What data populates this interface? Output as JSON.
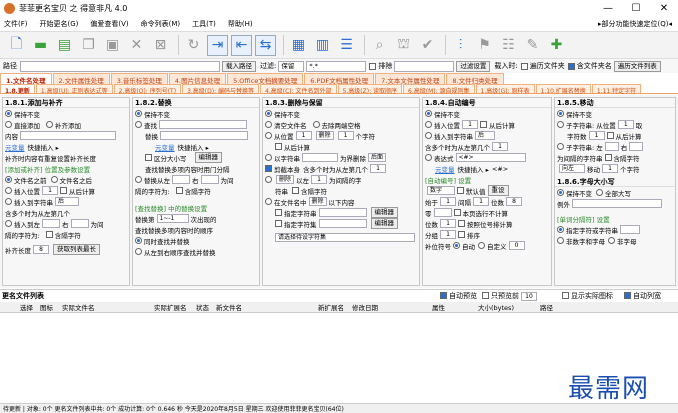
{
  "window": {
    "title": "菲菲更名宝贝 之 得意非凡 4.0"
  },
  "menu": {
    "items": [
      "文件(F)",
      "开始更名(G)",
      "偏爱查看(V)",
      "命令列表(M)",
      "工具(T)",
      "帮助(H)"
    ],
    "right": "▸部分功能快速定位(Q)◂"
  },
  "toolbar": {
    "icons": [
      "add-file-icon",
      "add-folder-icon",
      "add-folder-plus-icon",
      "copy-icon",
      "paste-icon",
      "delete-icon",
      "close-icon",
      "refresh-icon",
      "import-icon",
      "export-icon",
      "move-icon",
      "grid-icon",
      "table-icon",
      "list-icon",
      "search-icon",
      "theme-icon",
      "check-icon",
      "filter-icon",
      "flag-icon",
      "sliders-icon",
      "edit-icon",
      "pin-icon"
    ]
  },
  "pathbar": {
    "path_label": "路径",
    "path_value": "",
    "import_path": "载入路径",
    "filter_label": "过滤:",
    "filter_mode": "保留",
    "filter_value": "*.*",
    "exclude_label": "排除",
    "exclude_value": "",
    "filter_setting": "过滤设置",
    "load_label": "载入时:",
    "subfolder": "遍历文件夹",
    "include_folder": "含文件夹名",
    "traverse_list": "遍历文件列表"
  },
  "tabs": [
    "1.文件名处理",
    "2.文件属性处理",
    "3.音乐标签处理",
    "4.图片信息处理",
    "5.Office文档摘要处理",
    "6.PDF文档属性处理",
    "7.文本文件属性处理",
    "8.文件归类处理"
  ],
  "subtabs": [
    "1.8.更新",
    "1.高级(U): 正则表达式等",
    "2.高级(O): 序列号(T)",
    "3.高级(D): 编码与替换等",
    "4.高级(C): 文件名到外部",
    "5.高级(Z): 读取顺序",
    "6.高级(M): 源自规则集",
    "1.高级(G): 原样表",
    "1.10.扩展名替换",
    "1.11.特定字符"
  ],
  "panels": {
    "p1": {
      "title": "1.8.1.添加与补齐",
      "keep": "保持不变",
      "direct_add": "直接添加",
      "pad_add": "补齐添加",
      "content_label": "内容",
      "var_link": "元变量",
      "quick_insert": "快捷插入 ▸",
      "clear_insert": "补齐时内容有重复设置补齐长度",
      "group_head": "[添加或补齐] 位置及参数设置",
      "before_name": "文件名之前",
      "after_name": "文件名之后",
      "insert_pos": "插入位置",
      "pos_val": "1",
      "from_right": "从后计算",
      "insert_to_str": "插入到字符串",
      "after_lbl": "后",
      "multi_occur": "含多个时为从左第几个",
      "insert_to": "插入到左",
      "right_lbl": "右",
      "as_space": "为间",
      "gap_lbl": "隔的字符为:",
      "match_case": "含隔字符",
      "pad_len_lbl": "补齐长度",
      "pad_len": "8",
      "get_max": "获取列表最长"
    },
    "p2": {
      "title": "1.8.2.替换",
      "keep": "保持不变",
      "find": "查找",
      "replace": "替换",
      "var_link": "元变量",
      "quick_insert": "快捷插入 ▸",
      "case_sens": "区分大小写",
      "multi_replace": "查找替换多项内容时用门分隔",
      "editor": "编辑器",
      "replace_between": "替换从左",
      "right_lbl": "右",
      "as_space": "为间",
      "gap_lbl": "隔的字符为:",
      "gap_keep": "含隔字符",
      "group_head": "[查找替换] 中的替换设置",
      "replace_count": "替换第",
      "range": "1~-1",
      "times": "次出现的",
      "order_head": "查找替换多项内容时的顺序",
      "order1": "同时查找并替换",
      "order2": "从左到右顺序查找并替换"
    },
    "p3": {
      "title": "1.8.3.删除与保留",
      "keep": "保持不变",
      "clear_name": "清空文件名",
      "remove_space": "去除两端空格",
      "from_pos": "从位置",
      "pos_val": "1",
      "delete": "删除",
      "n1": "1",
      "chars": "个字符",
      "from_right": "从后计算",
      "with_str": "以字符串",
      "as_mark": "为界删除",
      "after": "后面",
      "cut_text": "剪截本身",
      "multi_occur": "含多个时为从左第几个",
      "n2": "1",
      "delete2": "删除",
      "to_left": "以左",
      "n3": "1",
      "as_gap": "为间隔的字",
      "str_lbl": "符串",
      "gap_keep": "含隔字符",
      "in_name": "在文件名中",
      "delete3": "删除",
      "below": "以下内容",
      "spec_str": "指定字符串",
      "editor": "编辑器",
      "spec_set": "指定字符集",
      "editor2": "编辑器",
      "choose_set": "请选择待设字符集"
    },
    "p4": {
      "title": "1.8.4.自动编号",
      "keep": "保持不变",
      "insert_pos": "插入位置",
      "pos_val": "1",
      "from_right": "从后计算",
      "insert_to_str": "插入到字符串",
      "after_lbl": "后",
      "multi_occur": "含多个时为从左第几个",
      "n1": "1",
      "expr": "表达式",
      "expr_val": "<#>",
      "var_link": "元变量",
      "quick_insert": "快捷插入 ▸",
      "sign": "<#>",
      "group_head": "[自动编号] 设置",
      "number": "数字",
      "base_lbl": "默认值",
      "reset": "重设",
      "start": "始于",
      "start_val": "1",
      "step": "间隔",
      "step_val": "1",
      "width": "位数",
      "width_val": "8",
      "zero": "零",
      "pad": "补位",
      "reset_cond": "本页选行不计算",
      "digit": "位数",
      "digit_val": "1",
      "skip": "跳过",
      "reorder": "按照位号排计算",
      "split": "分组",
      "split_val": "1",
      "sort": "排序",
      "pad_char": "补位符号",
      "auto": "自动",
      "custom": "自定义",
      "custom_val": "0"
    },
    "p5": {
      "title": "1.8.5.移动",
      "keep": "保持不变",
      "sub_str": "子字符串: 从位置",
      "pos_val": "1",
      "get": "取",
      "chars_lbl": "字符数",
      "n1": "1",
      "from_right": "从后计算",
      "sub_str2": "子字符串: 左",
      "right": "右",
      "as_gap": "为间隔的字符串",
      "gap_keep": "含隔字符",
      "direction": "向左",
      "move": "移动",
      "n2": "1",
      "chars2": "个字符",
      "title2": "1.8.6.字母大小写",
      "keep2": "保持不变",
      "all_upper": "全部大写",
      "example": "例外",
      "group_head": "[单词分隔符] 设置",
      "spec_chars": "指定字符或字符串",
      "non_alpha": "非数字和字母",
      "non_char": "非字母"
    }
  },
  "list": {
    "title": "更名文件列表",
    "auto_preview": "自动预览",
    "only_preview": "只预览前",
    "preview_n": "10",
    "show_icons": "显示实际图标",
    "auto_refresh": "自动列宽",
    "columns": [
      "选择",
      "图标",
      "实际文件名",
      "实际扩展名",
      "状态",
      "新文件名",
      "新扩展名",
      "修改日期",
      "属性",
      "大小(bytes)",
      "路径"
    ]
  },
  "status": {
    "text": "待更新 | 对象: 0个  更名文件列表中共: 0个  成功计算: 0个                              0.646 秒      今天是2020年8月5日 星期三  欢迎使用菲菲更名宝贝(64位)"
  },
  "watermark": "最需网"
}
